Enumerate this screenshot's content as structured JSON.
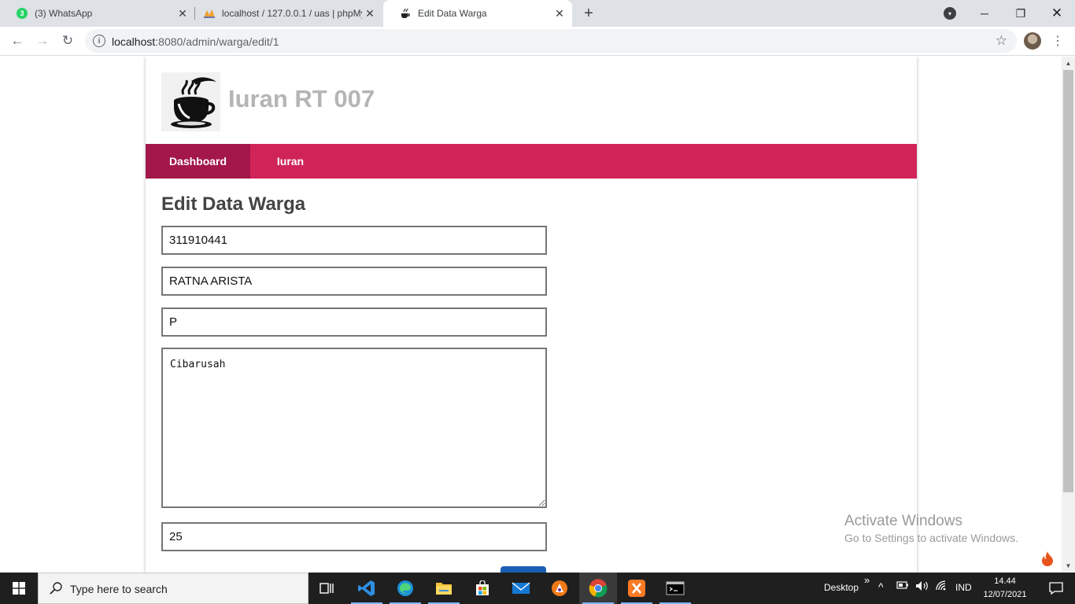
{
  "browser": {
    "tabs": [
      {
        "title": "(3) WhatsApp",
        "badge": "3",
        "icon": "whatsapp-icon"
      },
      {
        "title": "localhost / 127.0.0.1 / uas | phpMyAdmin",
        "icon": "phpmyadmin-icon"
      },
      {
        "title": "Edit Data Warga",
        "icon": "coffee-cup-icon",
        "active": true
      }
    ],
    "url_host": "localhost",
    "url_path": ":8080/admin/warga/edit/1"
  },
  "site": {
    "title": "Iuran RT 007",
    "nav": [
      {
        "label": "Dashboard",
        "active": true
      },
      {
        "label": "Iuran",
        "active": false
      }
    ],
    "accent": "#d02458",
    "accent_active": "#a3174a"
  },
  "form": {
    "heading": "Edit Data Warga",
    "fields": [
      {
        "value": "311910441"
      },
      {
        "value": "RATNA ARISTA"
      },
      {
        "value": "P"
      }
    ],
    "address": "Cibarusah",
    "last_field": "25"
  },
  "watermark": {
    "line1": "Activate Windows",
    "line2": "Go to Settings to activate Windows."
  },
  "taskbar": {
    "search_placeholder": "Type here to search",
    "desktop_label": "Desktop",
    "overflow": "»",
    "language": "IND",
    "time": "14.44",
    "date": "12/07/2021"
  }
}
